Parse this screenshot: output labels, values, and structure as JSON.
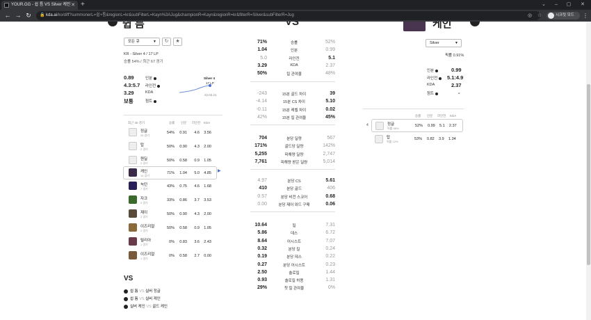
{
  "browser": {
    "tab_title": "YOUR.GG - 쉽 틈 VS Silver 케인",
    "url_host": "kda.ai",
    "url_path": "/ko/diff?summonerL=쉽+틈&regionL=kr&subFilterL=Kayn%3AJug&championR=Kayn&regionR=kr&filterR=Silver&subFilterR=Jug",
    "profile_label": "시크릿 모드"
  },
  "left": {
    "header": "쉽 틈",
    "filter_select": "모든 큐",
    "rank_text": "KR - Silver 4 / 17 LP",
    "record_text": "승률 54% / 최근 67 경기",
    "stats": [
      {
        "value": "0.89",
        "label": "인분"
      },
      {
        "value": "4.3:5.7",
        "label": "라인전"
      },
      {
        "value": "3.29",
        "label": "KDA"
      },
      {
        "value": "보통",
        "label": "첨트"
      }
    ],
    "graph": {
      "tier": "Silver 4",
      "lp": "17 LP",
      "date": "22.03.21"
    },
    "table_header": {
      "recent": "최근 30 경기",
      "win": "승률",
      "ibun": "인분",
      "lane": "라인전",
      "kda": "KDA"
    },
    "positions": [
      {
        "name": "정글",
        "games": "26 경기",
        "win": "54%",
        "ibun": "0.91",
        "lane": "4.6",
        "kda": "3.56"
      },
      {
        "name": "탑",
        "games": "2 경기",
        "win": "50%",
        "ibun": "0.90",
        "lane": "4.3",
        "kda": "2.00"
      },
      {
        "name": "원딜",
        "games": "2 경기",
        "win": "50%",
        "ibun": "0.58",
        "lane": "0.9",
        "kda": "1.05"
      }
    ],
    "champions": [
      {
        "name": "케인",
        "games": "14 경기",
        "win": "71%",
        "ibun": "1.04",
        "lane": "5.0",
        "kda": "4.85",
        "color": "#3a2a4a"
      },
      {
        "name": "녹턴",
        "games": "7 경기",
        "win": "43%",
        "ibun": "0.75",
        "lane": "4.6",
        "kda": "1.68",
        "color": "#2a1f5a"
      },
      {
        "name": "자크",
        "games": "3 경기",
        "win": "33%",
        "ibun": "0.86",
        "lane": "3.7",
        "kda": "3.53",
        "color": "#3a6a2a"
      },
      {
        "name": "제이",
        "games": "2 경기",
        "win": "50%",
        "ibun": "0.90",
        "lane": "4.3",
        "kda": "2.00",
        "color": "#5a4a3a"
      },
      {
        "name": "이즈리얼",
        "games": "2 경기",
        "win": "50%",
        "ibun": "0.58",
        "lane": "0.9",
        "kda": "1.05",
        "color": "#8a6a3a"
      },
      {
        "name": "릴리아",
        "games": "1 경기",
        "win": "0%",
        "ibun": "0.83",
        "lane": "3.6",
        "kda": "2.43",
        "color": "#6a3a4a"
      },
      {
        "name": "이즈리얼",
        "games": "1 경기",
        "win": "0%",
        "ibun": "0.58",
        "lane": "2.7",
        "kda": "0.00",
        "color": "#7a5a3a"
      }
    ],
    "vs_title": "VS",
    "vs_items": [
      {
        "a": "쉽 틈",
        "b": "실버 정글"
      },
      {
        "a": "쉽 틈",
        "b": "실버 케인"
      },
      {
        "a": "실버 케인",
        "b": "골드 케인"
      }
    ]
  },
  "center": {
    "header": "VS",
    "groups": [
      [
        {
          "l": "71%",
          "label": "승률",
          "r": "52%"
        },
        {
          "l": "1.04",
          "label": "인분",
          "r": "0.99"
        },
        {
          "l": "5.0",
          "label": "라인전",
          "r": "5.1"
        },
        {
          "l": "3.29",
          "label": "KDA",
          "r": "2.37"
        },
        {
          "l": "50%",
          "label": "킬 관여율",
          "r": "48%"
        }
      ],
      [
        {
          "l": "-243",
          "label": "15분 골드 차이",
          "r": "39"
        },
        {
          "l": "-4.14",
          "label": "15분 CS 차이",
          "r": "5.10"
        },
        {
          "l": "-0.11",
          "label": "15분 레벨 차이",
          "r": "0.02"
        },
        {
          "l": "42%",
          "label": "15분 킬 관여율",
          "r": "45%"
        }
      ],
      [
        {
          "l": "704",
          "label": "분당 딜량",
          "r": "567"
        },
        {
          "l": "171%",
          "label": "골드당 딜량",
          "r": "142%"
        },
        {
          "l": "5,255",
          "label": "피해량 딜량",
          "r": "2,747"
        },
        {
          "l": "7,761",
          "label": "피해량 받은 딜량",
          "r": "5,014"
        }
      ],
      [
        {
          "l": "4.97",
          "label": "분당 CS",
          "r": "5.61"
        },
        {
          "l": "410",
          "label": "분당 골드",
          "r": "406"
        },
        {
          "l": "0.57",
          "label": "분당 비전 스코어",
          "r": "0.68"
        },
        {
          "l": "0.00",
          "label": "분당 제어 와드 구매",
          "r": "0.06"
        }
      ],
      [
        {
          "l": "10.64",
          "label": "킬",
          "r": "7.31"
        },
        {
          "l": "5.86",
          "label": "데스",
          "r": "6.72"
        },
        {
          "l": "8.64",
          "label": "어시스트",
          "r": "7.07"
        },
        {
          "l": "0.32",
          "label": "분당 킬",
          "r": "0.24"
        },
        {
          "l": "0.19",
          "label": "분당 데스",
          "r": "0.22"
        },
        {
          "l": "0.27",
          "label": "분당 어시스트",
          "r": "0.23"
        },
        {
          "l": "2.50",
          "label": "솔로킬",
          "r": "1.44"
        },
        {
          "l": "0.93",
          "label": "솔로킬 허용",
          "r": "1.31"
        },
        {
          "l": "29%",
          "label": "첫 킬 관여율",
          "r": "0%"
        }
      ]
    ]
  },
  "right": {
    "header": "케인",
    "filter_select": "Silver",
    "record_text": "픽률 0.91%",
    "stats": [
      {
        "label": "인분",
        "value": "0.99"
      },
      {
        "label": "라인전",
        "value": "5.1:4.9"
      },
      {
        "label": "KDA",
        "value": "2.37"
      },
      {
        "label": "첨트",
        "value": "-"
      }
    ],
    "table_header": {
      "win": "승률",
      "ibun": "인분",
      "lane": "라인전",
      "kda": "KDA"
    },
    "positions": [
      {
        "name": "정글",
        "pick": "픽률 88%",
        "win": "52%",
        "ibun": "0.99",
        "lane": "5.1",
        "kda": "2.37"
      },
      {
        "name": "탑",
        "pick": "픽률 12%",
        "win": "53%",
        "ibun": "0.82",
        "lane": "3.9",
        "kda": "1.34"
      }
    ]
  }
}
